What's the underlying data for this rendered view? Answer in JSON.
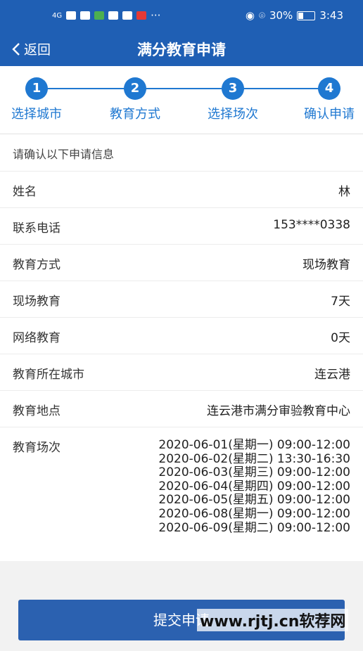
{
  "status_bar": {
    "battery": "30%",
    "time": "3:43",
    "signal": "4G"
  },
  "nav": {
    "back_label": "返回",
    "title": "满分教育申请"
  },
  "steps": [
    {
      "num": "1",
      "label": "选择城市"
    },
    {
      "num": "2",
      "label": "教育方式"
    },
    {
      "num": "3",
      "label": "选择场次"
    },
    {
      "num": "4",
      "label": "确认申请"
    }
  ],
  "intro": "请确认以下申请信息",
  "rows": [
    {
      "label": "姓名",
      "value": "林"
    },
    {
      "label": "联系电话",
      "value": "153****0338"
    },
    {
      "label": "教育方式",
      "value": "现场教育"
    },
    {
      "label": "现场教育",
      "value": "7天"
    },
    {
      "label": "网络教育",
      "value": "0天"
    },
    {
      "label": "教育所在城市",
      "value": "连云港"
    },
    {
      "label": "教育地点",
      "value": "连云港市满分审验教育中心"
    }
  ],
  "sessions": {
    "label": "教育场次",
    "items": [
      "2020-06-01(星期一) 09:00-12:00",
      "2020-06-02(星期二) 13:30-16:30",
      "2020-06-03(星期三) 09:00-12:00",
      "2020-06-04(星期四) 09:00-12:00",
      "2020-06-05(星期五) 09:00-12:00",
      "2020-06-08(星期一) 09:00-12:00",
      "2020-06-09(星期二) 09:00-12:00"
    ]
  },
  "submit_label": "提交申请",
  "watermark": "www.rjtj.cn软荐网",
  "colors": {
    "primary": "#1f5fb4",
    "step": "#1f78d1",
    "button": "#2b61b0"
  }
}
